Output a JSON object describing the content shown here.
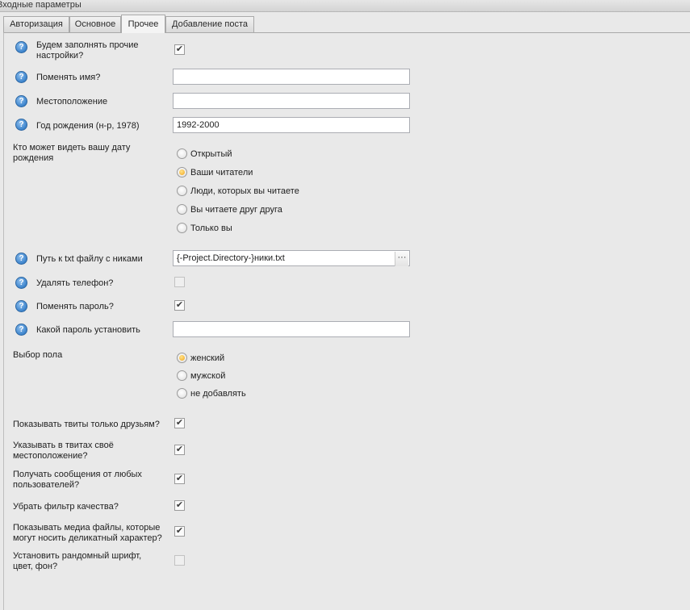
{
  "window": {
    "title": "Входные параметры"
  },
  "tabs": [
    {
      "label": "Авторизация"
    },
    {
      "label": "Основное"
    },
    {
      "label": "Прочее"
    },
    {
      "label": "Добавление поста"
    }
  ],
  "active_tab": "Прочее",
  "help_icon_glyph": "?",
  "colors": {
    "help_icon": "#3d84cc",
    "radio_selected": "#f2a51d"
  },
  "fields": {
    "fill_other": {
      "label": "Будем заполнять прочие настройки?",
      "checked": true
    },
    "change_name": {
      "label": "Поменять имя?",
      "value": ""
    },
    "location": {
      "label": "Местоположение",
      "value": ""
    },
    "birth_year": {
      "label": "Год рождения (н-р, 1978)",
      "value": "1992-2000"
    },
    "who_sees_birthdate": {
      "label": "Кто может видеть вашу дату рождения",
      "options": [
        "Открытый",
        "Ваши читатели",
        "Люди, которых вы читаете",
        "Вы читаете друг друга",
        "Только вы"
      ],
      "selected": "Ваши читатели"
    },
    "nicks_file": {
      "label": "Путь к txt файлу с никами",
      "value": "{-Project.Directory-}ники.txt",
      "browse_label": "···"
    },
    "delete_phone": {
      "label": "Удалять телефон?",
      "checked": false
    },
    "change_password": {
      "label": "Поменять пароль?",
      "checked": true
    },
    "new_password": {
      "label": "Какой пароль установить",
      "value": ""
    },
    "gender": {
      "label": "Выбор пола",
      "options": [
        "женский",
        "мужской",
        "не добавлять"
      ],
      "selected": "женский"
    },
    "tweets_friends_only": {
      "label": "Показывать твиты только друзьям?",
      "checked": true
    },
    "tweet_location": {
      "label": "Указывать в твитах своё местоположение?",
      "checked": true
    },
    "messages_any_users": {
      "label": "Получать сообщения от любых пользователей?",
      "checked": true
    },
    "remove_quality_filter": {
      "label": "Убрать фильтр качества?",
      "checked": true
    },
    "show_sensitive_media": {
      "label": "Показывать медиа файлы, которые могут носить деликатный характер?",
      "checked": true
    },
    "random_font": {
      "label": "Установить рандомный шрифт, цвет, фон?",
      "checked": false
    }
  }
}
